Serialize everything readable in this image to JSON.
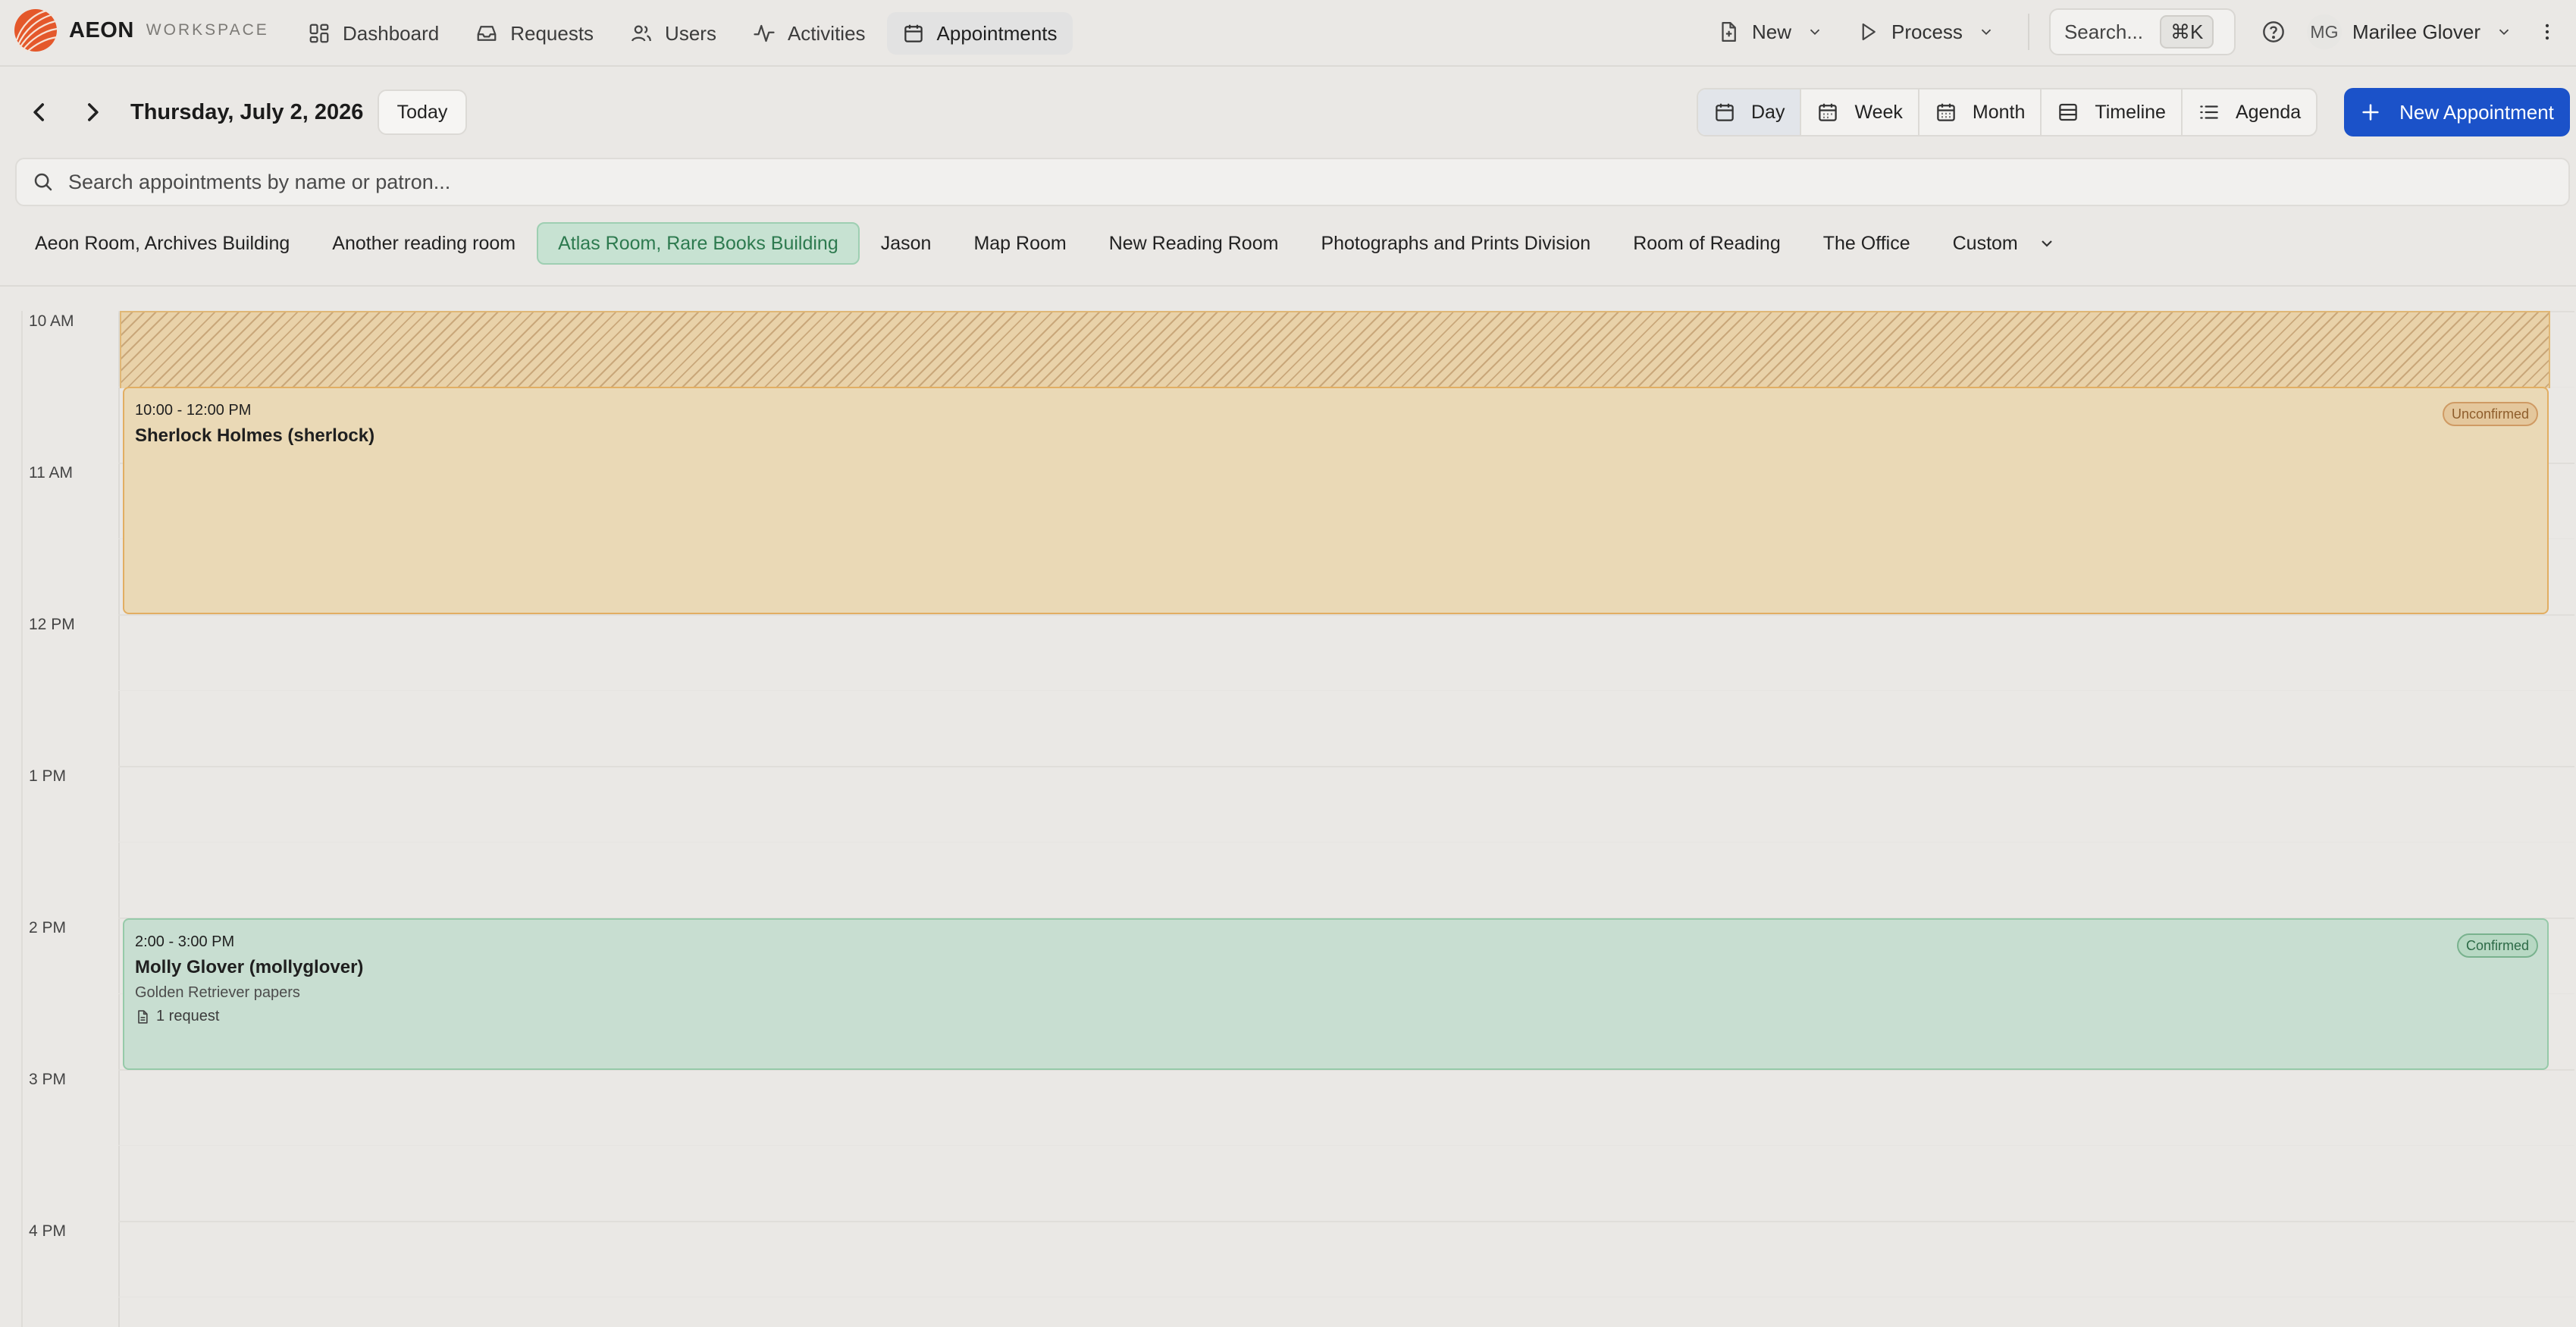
{
  "brand": {
    "name": "AEON",
    "sub": "WORKSPACE"
  },
  "nav": {
    "items": [
      {
        "label": "Dashboard",
        "icon": "dashboard-icon"
      },
      {
        "label": "Requests",
        "icon": "inbox-icon"
      },
      {
        "label": "Users",
        "icon": "users-icon"
      },
      {
        "label": "Activities",
        "icon": "activity-icon"
      },
      {
        "label": "Appointments",
        "icon": "calendar-icon",
        "active": true
      }
    ]
  },
  "topRight": {
    "new_label": "New",
    "process_label": "Process",
    "search_label": "Search...",
    "search_shortcut": "⌘K",
    "user_initials": "MG",
    "user_name": "Marilee Glover"
  },
  "toolbar": {
    "date": "Thursday, July 2, 2026",
    "today_label": "Today",
    "views": [
      {
        "label": "Day",
        "icon": "calendar-day-icon",
        "active": true
      },
      {
        "label": "Week",
        "icon": "calendar-week-icon"
      },
      {
        "label": "Month",
        "icon": "calendar-month-icon"
      },
      {
        "label": "Timeline",
        "icon": "timeline-icon"
      },
      {
        "label": "Agenda",
        "icon": "list-icon"
      }
    ],
    "new_appointment_label": "New Appointment"
  },
  "search": {
    "placeholder": "Search appointments by name or patron..."
  },
  "rooms": {
    "tabs": [
      "Aeon Room, Archives Building",
      "Another reading room",
      "Atlas Room, Rare Books Building",
      "Jason",
      "Map Room",
      "New Reading Room",
      "Photographs and Prints Division",
      "Room of Reading",
      "The Office"
    ],
    "active_tab": "Atlas Room, Rare Books Building",
    "custom_label": "Custom"
  },
  "calendar": {
    "hours": [
      "10 AM",
      "11 AM",
      "12 PM",
      "1 PM",
      "2 PM",
      "3 PM",
      "4 PM"
    ],
    "events": [
      {
        "time": "10:00 - 12:00 PM",
        "title": "Sherlock Holmes (sherlock)",
        "status": "Unconfirmed"
      },
      {
        "time": "2:00 - 3:00 PM",
        "title": "Molly Glover (mollyglover)",
        "subtitle": "Golden Retriever papers",
        "requests": "1 request",
        "status": "Confirmed"
      }
    ]
  },
  "colors": {
    "accent": "#1b52c9",
    "unconfirmed_bg": "#ead9b6",
    "confirmed_bg": "#c8ded1",
    "active_room": "#c7e2d2"
  }
}
